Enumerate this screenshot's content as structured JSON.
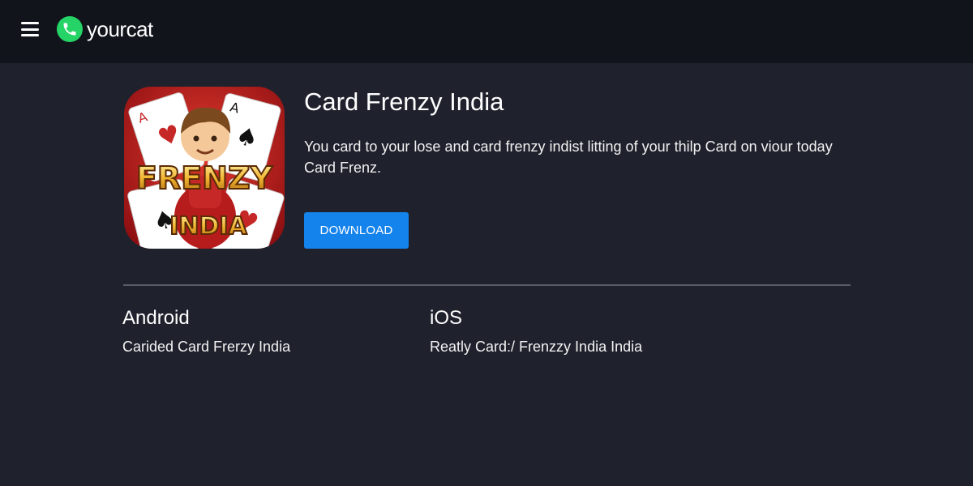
{
  "header": {
    "brand": "yourcat",
    "icons": {
      "menu": "hamburger-menu-icon",
      "logo": "phone-logo-icon"
    },
    "logo_color": "#25d366"
  },
  "app": {
    "title": "Card Frenzy India",
    "description": "You card to your lose and card frenzy indist litting of your thilp Card on viour today Card Frenz.",
    "download_label": "DOWNLOAD",
    "icon_art": {
      "word_top": "FRENZY",
      "word_bottom": "INDIA"
    }
  },
  "platforms": {
    "android": {
      "heading": "Android",
      "text": "Carided Card Frerzy India"
    },
    "ios": {
      "heading": "iOS",
      "text": "Reatly Card:/ Frenzzy India India"
    }
  },
  "colors": {
    "background": "#1f222d",
    "header": "#12141c",
    "accent": "#1583ec",
    "divider": "#5a5d67"
  }
}
